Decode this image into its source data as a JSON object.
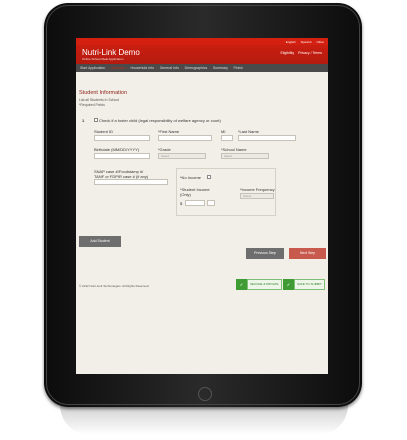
{
  "topbar": {
    "links": [
      "English",
      "Spanish",
      "Other"
    ]
  },
  "header": {
    "title": "Nutri-Link Demo",
    "subtitle": "Online School Meal Application",
    "links": [
      "Eligibility",
      "Privacy / Terms"
    ]
  },
  "nav": {
    "items": [
      "Start Application",
      "Students",
      "Household Info",
      "General Info",
      "Demographics",
      "Summary",
      "Finish"
    ],
    "active_index": 1
  },
  "form": {
    "heading": "Student Information",
    "list_note": "List all Students in School",
    "required_note": "*Required Fields",
    "row_number": "1",
    "foster_label": "Check if a foster child (legal responsibility of welfare agency or court)",
    "student_id_label": "Student ID",
    "first_name_label": "*First Name",
    "mi_label": "MI",
    "last_name_label": "*Last Name",
    "birthdate_label": "Birthdate (MM/DD/YYYY)",
    "grade_label": "*Grade",
    "grade_value": "Select",
    "school_label": "*School Name",
    "school_value": "Select",
    "snap_label_1": "SNAP case #/Foodstamp #/",
    "snap_label_2": "TANF or FDPIR case # (if any)",
    "no_income_label": "*No Income",
    "income_label_1": "*Student Income",
    "income_label_2": "(Only)",
    "dollar": "$",
    "frequency_label": "*Income Frequency",
    "frequency_value": "Select"
  },
  "buttons": {
    "add_student": "Add Student",
    "previous": "Previous Step",
    "next": "Next Step"
  },
  "footer": {
    "copyright": "© 2012 Nutri-Link Technologies. All Rights Reserved.",
    "badge1": "SECURE & PRIVATE",
    "badge2": "SAFE TO SUBMIT"
  },
  "colors": {
    "brand_red": "#c91e10",
    "nav_gray": "#4a4a4a",
    "button_gray": "#6e6e6e",
    "button_red": "#c75a4c"
  }
}
